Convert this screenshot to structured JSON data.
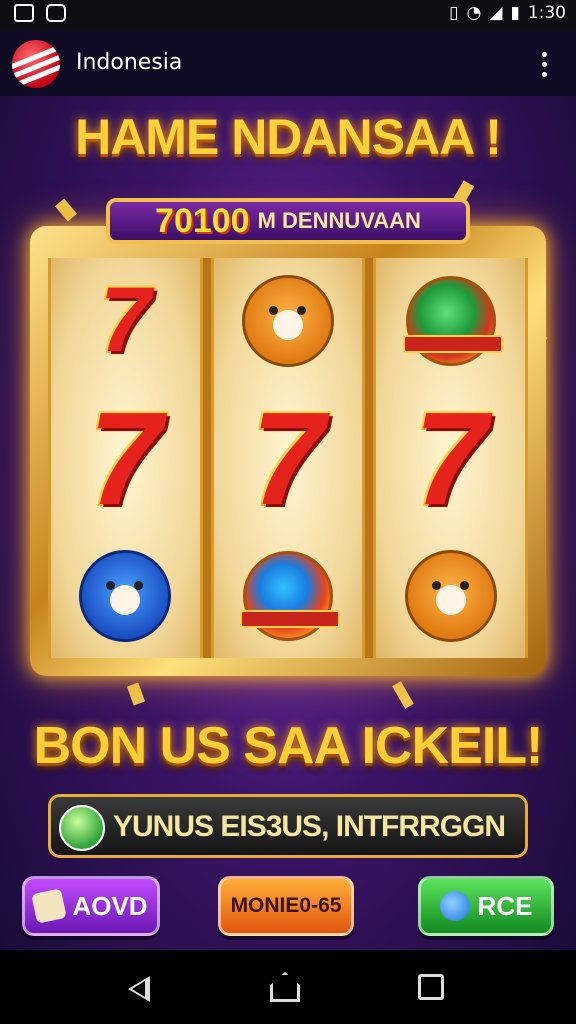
{
  "status_bar": {
    "time": "1:30",
    "icons": [
      "gallery-icon",
      "camera-icon",
      "vibrate-icon",
      "wifi-icon",
      "signal-icon",
      "battery-icon"
    ]
  },
  "app_bar": {
    "title": "Indonesia",
    "logo_icon": "red-white-swoosh-logo",
    "menu_icon": "kebab-menu-icon"
  },
  "game": {
    "title": "HAME NDANSAA !",
    "banner_number": "70100",
    "banner_text": "M DENNUVAAN",
    "reels": [
      [
        "seven",
        "seven",
        "blue-tiger-badge"
      ],
      [
        "tiger-badge",
        "seven",
        "fire-orb"
      ],
      [
        "green-orb",
        "seven",
        "tiger-head"
      ]
    ],
    "bonus_text": "BON US SAA ICKEIL!",
    "info_bar": {
      "text": "YUNUS EIS3US, INTFRRGGN",
      "icon": "green-gem-icon"
    },
    "buttons": [
      {
        "label": "AOVD",
        "color": "#9b2fe0",
        "icon": "dice-icon"
      },
      {
        "label": "MONIE0-65",
        "color": "#f07818"
      },
      {
        "label": "RCE",
        "color": "#28b83a",
        "icon": "coin-icon"
      }
    ]
  },
  "colors": {
    "gold": "#ffd23a",
    "frame_gold": "#e0a22c",
    "background": "#3b1466",
    "seven_red": "#e5221c"
  },
  "nav_bar": {
    "icons": [
      "back-icon",
      "home-icon",
      "recents-icon"
    ]
  }
}
